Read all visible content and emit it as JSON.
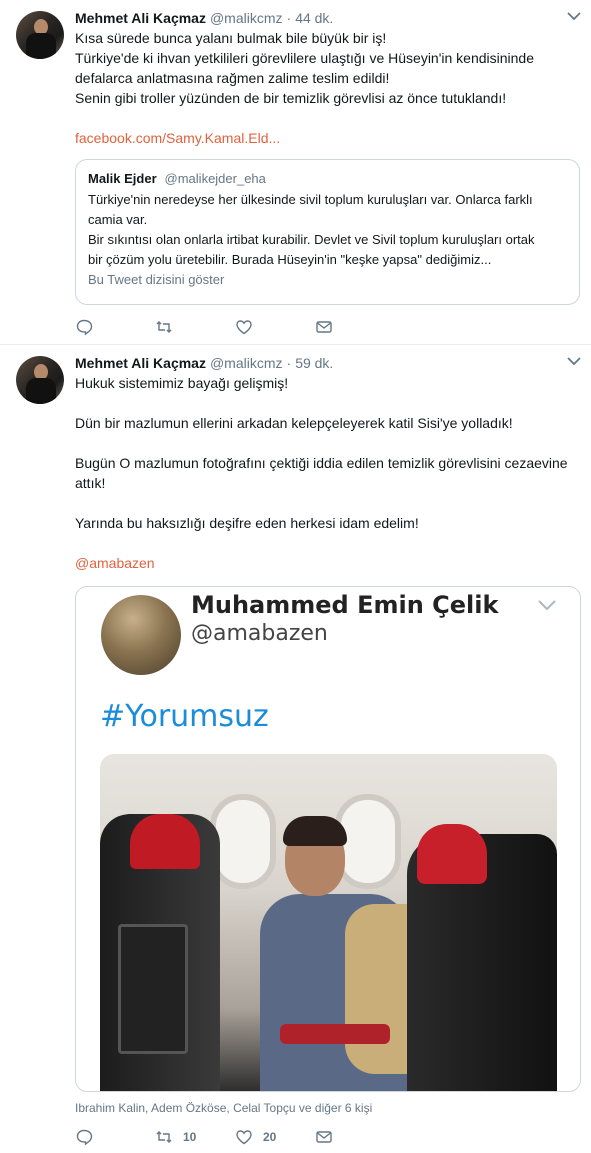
{
  "tweet1": {
    "name": "Mehmet Ali Kaçmaz",
    "handle": "@malikcmz",
    "time": "44 dk.",
    "lines": [
      "Kısa sürede bunca yalanı bulmak bile büyük bir iş!",
      "Türkiye'de ki ihvan yetkilileri görevlilere ulaştığı ve Hüseyin'in kendisininde",
      "defalarca anlatmasına rağmen zalime teslim edildi!",
      "Senin gibi troller yüzünden de bir temizlik görevlisi az önce tutuklandı!",
      ""
    ],
    "link": "facebook.com/Samy.Kamal.Eld...",
    "quote": {
      "name": "Malik Ejder",
      "handle": "@malikejder_eha",
      "lines": [
        "Türkiye'nin neredeyse her ülkesinde sivil toplum kuruluşları var. Onlarca farklı",
        "camia var.",
        "Bir sıkıntısı olan onlarla irtibat kurabilir. Devlet ve Sivil toplum kuruluşları ortak",
        "bir çözüm yolu üretebilir. Burada Hüseyin'in \"keşke yapsa\" dediğimiz..."
      ],
      "show_thread": "Bu Tweet dizisini göster"
    },
    "actions": {
      "reply": "",
      "retweet": "",
      "like": "",
      "message": ""
    }
  },
  "tweet2": {
    "name": "Mehmet Ali Kaçmaz",
    "handle": "@malikcmz",
    "time": "59 dk.",
    "lines": [
      "Hukuk sistemimiz bayağı gelişmiş!",
      "",
      "Dün bir mazlumun ellerini arkadan kelepçeleyerek katil Sisi'ye yolladık!",
      "",
      "Bugün O mazlumun fotoğrafını çektiği iddia edilen temizlik görevlisini cezaevine",
      "attık!",
      "",
      "Yarında bu haksızlığı deşifre eden herkesi idam edelim!",
      ""
    ],
    "mention": "@amabazen",
    "media": {
      "name": "Muhammed Emin Çelik",
      "handle": "@amabazen",
      "hashtag": "#Yorumsuz"
    },
    "likers": "Ibrahim Kalin, Adem Özköse, Celal Topçu ve diğer 6 kişi",
    "actions": {
      "reply": "",
      "retweet": "10",
      "like": "20",
      "message": ""
    }
  },
  "colors": {
    "link": "#e0623d",
    "muted": "#657786",
    "hashtag": "#1a8cd8",
    "border": "#e6ecf0"
  },
  "icons": [
    "chevron-down-icon",
    "reply-icon",
    "retweet-icon",
    "like-icon",
    "message-icon"
  ]
}
